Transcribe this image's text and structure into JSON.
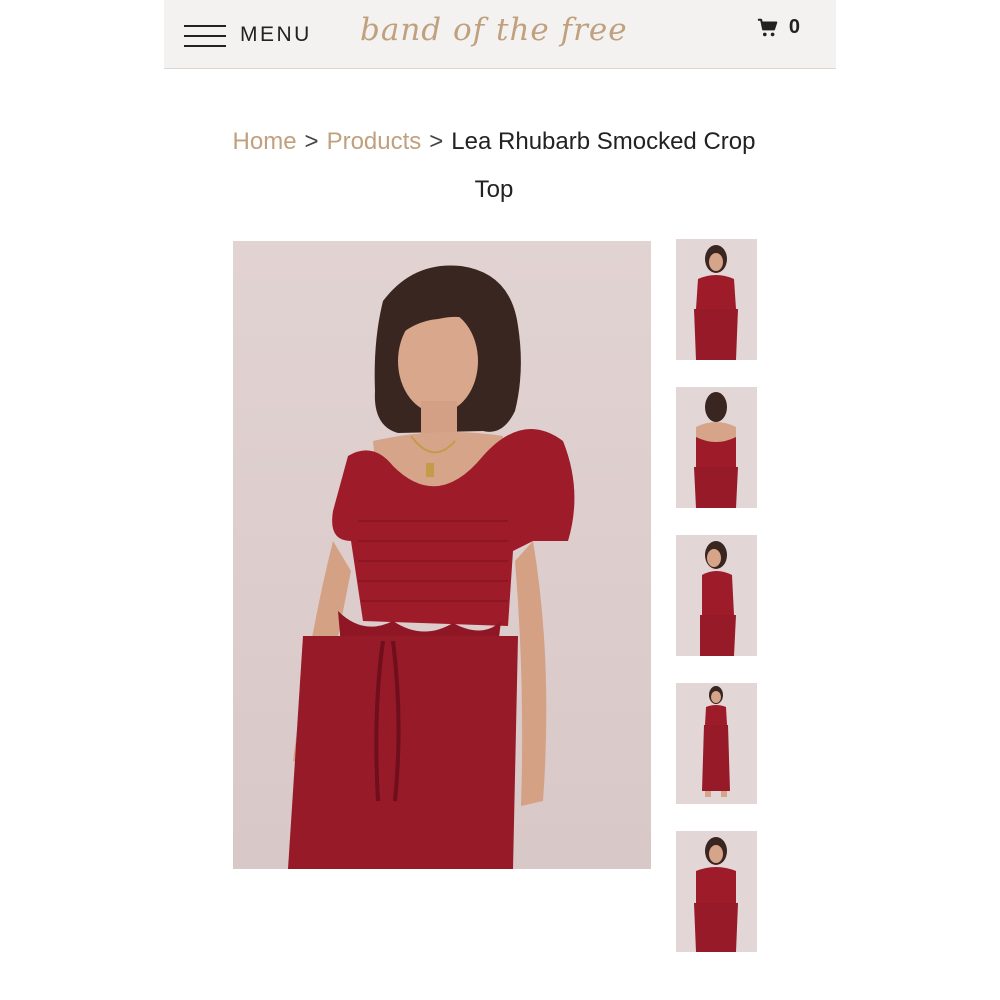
{
  "header": {
    "menu_label": "MENU",
    "logo_text": "band of the free",
    "cart_count": "0"
  },
  "breadcrumb": {
    "items": [
      "Home",
      "Products"
    ],
    "separator": ">",
    "current": "Lea Rhubarb Smocked Crop Top"
  },
  "product": {
    "main_image": "model-in-red-smocked-crop-top-front",
    "thumbnails": [
      "front-view",
      "back-view",
      "side-view",
      "full-length-view",
      "front-view-alt"
    ]
  },
  "colors": {
    "accent": "#c1a07e",
    "header_bg": "#f3f2f1",
    "garment": "#9e1b2a",
    "backdrop": "#e0d1d1"
  }
}
